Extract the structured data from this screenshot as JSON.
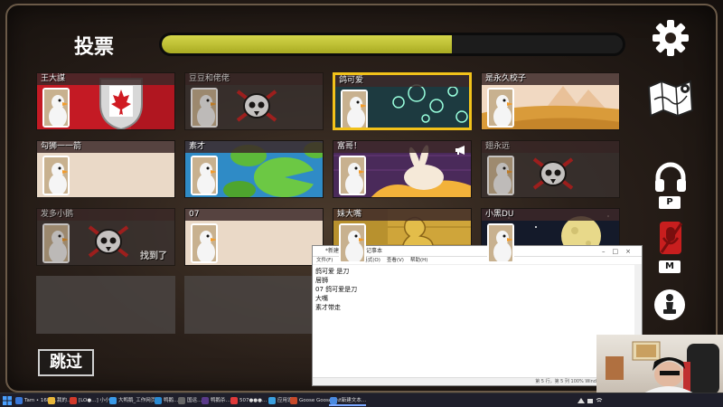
{
  "screen": {
    "title": "投票",
    "timer_progress": 0.63,
    "skip_label": "跳过"
  },
  "players": [
    {
      "name": "王大謀",
      "theme": "canada-flag",
      "status": "alive",
      "selected": false
    },
    {
      "name": "豆豆和佬佬",
      "theme": "dark",
      "status": "dead",
      "selected": false
    },
    {
      "name": "鸽可爱",
      "theme": "bubbles",
      "status": "alive",
      "selected": true
    },
    {
      "name": "是永久校子",
      "theme": "desert-pyramids",
      "status": "alive",
      "selected": false
    },
    {
      "name": "勾狮一一箭",
      "theme": "beige",
      "status": "alive",
      "selected": false
    },
    {
      "name": "素才",
      "theme": "lily-pads",
      "status": "alive",
      "selected": false
    },
    {
      "name": "富哥！",
      "theme": "rabbit-bricks",
      "status": "alive",
      "selected": false,
      "megaphone": true
    },
    {
      "name": "翅永远",
      "theme": "dark",
      "status": "dead",
      "selected": false
    },
    {
      "name": "发多小鹅",
      "theme": "dark",
      "status": "dead",
      "selected": false,
      "found_label": "找到了"
    },
    {
      "name": "07",
      "theme": "beige",
      "status": "alive",
      "selected": false
    },
    {
      "name": "妹大嘴",
      "theme": "gold-duck",
      "status": "alive",
      "selected": false
    },
    {
      "name": "小黑DU",
      "theme": "night-moon",
      "status": "alive",
      "selected": false
    }
  ],
  "sidebar": {
    "settings_icon": "gear-icon",
    "map_icon": "map-icon",
    "push_to_talk_key": "P",
    "mute_key": "M",
    "chess_icon": "chess-pawn-icon"
  },
  "notepad": {
    "title": "*新建文本文档 - 记事本",
    "menu": [
      "文件(F)",
      "编辑(E)",
      "格式(O)",
      "查看(V)",
      "帮助(H)"
    ],
    "lines": [
      "鸽可爱 是刀",
      "居狮",
      "07 鸽可爱是刀",
      "大嘴",
      "素才带走"
    ],
    "status": "第 5 行，第 5 列   100%   Windows (CRLF)   UTF-8"
  },
  "taskbar": {
    "items": [
      {
        "label": "Tam • 1680…",
        "color": "#3a78d8"
      },
      {
        "label": "我的…",
        "color": "#e8b73a"
      },
      {
        "label": "[LO●…] 小小…",
        "color": "#d23a2a"
      },
      {
        "label": "大鸭鹅_工作网页…",
        "color": "#3a9ae8"
      },
      {
        "label": "鸭鹅…",
        "color": "#2a8ad2"
      },
      {
        "label": "国运…",
        "color": "#666"
      },
      {
        "label": "鸭鹅杀…",
        "color": "#5a3a8a"
      },
      {
        "label": "507●●●…",
        "color": "#e03a3a"
      },
      {
        "label": "应用设置",
        "color": "#3aa0e0"
      },
      {
        "label": "Goose Goose Du…",
        "color": "#c84a2a"
      },
      {
        "label": "*新建文本…",
        "color": "#4a8ae0",
        "active": true
      }
    ],
    "tray_time": "",
    "tray_date": ""
  }
}
